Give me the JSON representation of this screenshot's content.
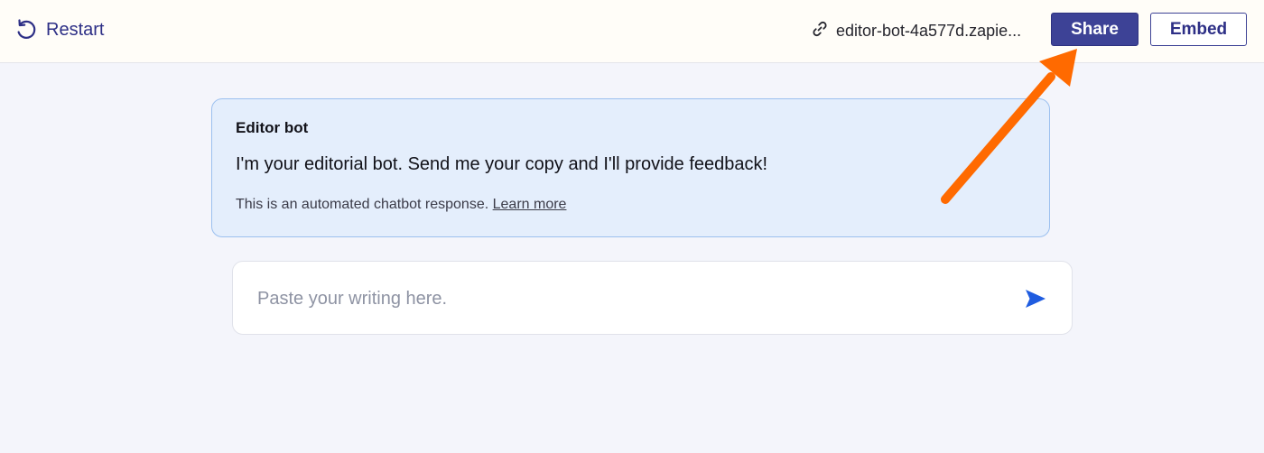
{
  "header": {
    "restart_label": "Restart",
    "bot_url": "editor-bot-4a577d.zapie...",
    "share_label": "Share",
    "embed_label": "Embed",
    "icons": {
      "restart": "restart-icon",
      "link": "link-icon"
    }
  },
  "chat": {
    "bot_name": "Editor bot",
    "message": "I'm your editorial bot. Send me your copy and I'll provide feedback!",
    "note_text": "This is an automated chatbot response.",
    "learn_more": "Learn more"
  },
  "composer": {
    "placeholder": "Paste your writing here.",
    "value": "",
    "send_icon": "send-icon"
  },
  "colors": {
    "brand": "#3d4296",
    "card_bg": "#e4eefc",
    "card_border": "#9cc0ef",
    "send": "#1f5ce0",
    "annotation_arrow": "#ff6a00"
  }
}
